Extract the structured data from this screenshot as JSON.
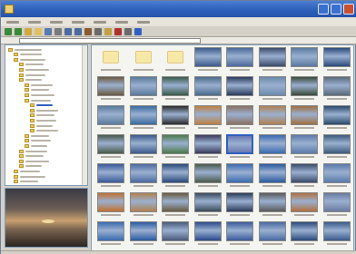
{
  "window": {
    "title": "",
    "accent": "#2c5db8"
  },
  "menubar": {
    "items": [
      "",
      "",
      "",
      "",
      "",
      "",
      ""
    ]
  },
  "toolbar": {
    "tools": [
      {
        "icon": "back-icon",
        "color": "#3a8a3a"
      },
      {
        "icon": "forward-icon",
        "color": "#3a8a3a"
      },
      {
        "icon": "up-folder-icon",
        "color": "#d0a840"
      },
      {
        "icon": "folder-icon",
        "color": "#e0c060"
      },
      {
        "icon": "view-icon",
        "color": "#5a7ab0"
      },
      {
        "icon": "zoom-icon",
        "color": "#7a7a7a"
      },
      {
        "icon": "rotate-left-icon",
        "color": "#4a6aa0"
      },
      {
        "icon": "rotate-right-icon",
        "color": "#4a6aa0"
      },
      {
        "icon": "slideshow-icon",
        "color": "#8a5a30"
      },
      {
        "icon": "print-icon",
        "color": "#6a6a6a"
      },
      {
        "icon": "email-icon",
        "color": "#c0a040"
      },
      {
        "icon": "delete-icon",
        "color": "#b03030"
      },
      {
        "icon": "settings-icon",
        "color": "#6a6a6a"
      },
      {
        "icon": "help-icon",
        "color": "#3060c0"
      }
    ]
  },
  "sidebar": {
    "tree": [
      {
        "level": 0,
        "w": 30
      },
      {
        "level": 1,
        "w": 24
      },
      {
        "level": 1,
        "w": 28
      },
      {
        "level": 2,
        "w": 20
      },
      {
        "level": 2,
        "w": 26
      },
      {
        "level": 2,
        "w": 22
      },
      {
        "level": 2,
        "w": 18
      },
      {
        "level": 3,
        "w": 24
      },
      {
        "level": 3,
        "w": 20
      },
      {
        "level": 3,
        "w": 26
      },
      {
        "level": 3,
        "w": 22
      },
      {
        "level": 4,
        "w": 18,
        "selected": true
      },
      {
        "level": 4,
        "w": 24
      },
      {
        "level": 4,
        "w": 20
      },
      {
        "level": 4,
        "w": 22
      },
      {
        "level": 4,
        "w": 18
      },
      {
        "level": 4,
        "w": 24
      },
      {
        "level": 3,
        "w": 20
      },
      {
        "level": 3,
        "w": 22
      },
      {
        "level": 3,
        "w": 18
      },
      {
        "level": 2,
        "w": 24
      },
      {
        "level": 2,
        "w": 20
      },
      {
        "level": 2,
        "w": 26
      },
      {
        "level": 2,
        "w": 18
      },
      {
        "level": 1,
        "w": 22
      },
      {
        "level": 1,
        "w": 28
      },
      {
        "level": 1,
        "w": 20
      }
    ]
  },
  "thumbnails": [
    [
      "folder",
      "folder",
      "folder",
      "#3a5a8a",
      "#4a6a9a",
      "#3a4a6a",
      "#5a7aa0",
      "#2a4a7a"
    ],
    [
      "#6a5a40",
      "#5a7a9a",
      "#3a5a4a",
      "#4a6a8a",
      "#2a3a5a",
      "#6a8aaa",
      "#3a4a3a",
      "#5a6a7a"
    ],
    [
      "#5a7a9a",
      "#3a6aa0",
      "#2a2a2a",
      "#c08040",
      "#8a7060",
      "#b08050",
      "#a07040",
      "#2a4a6a"
    ],
    [
      "#4a5a4a",
      "#3a5a8a",
      "#4a7a4a",
      "#3a3a5a",
      "#6a7ab0",
      "#3a6ab0",
      "#5a7aaa",
      "#3a5a7a"
    ],
    [
      "#3a5a9a",
      "#4a6aa0",
      "#2a4a7a",
      "#4a5a4a",
      "#3a6ab0",
      "#2a5aa0",
      "#3a4a6a",
      "#5a7aaa"
    ],
    [
      "#c07030",
      "#b08050",
      "#6a5a40",
      "#3a4a5a",
      "#2a3a5a",
      "#5a5a5a",
      "#b07040",
      "#6a7aa0"
    ],
    [
      "#3a6ab0",
      "#2a5aa0",
      "#4a5a7a",
      "#2a4a8a",
      "#3a5a9a",
      "#4a6aa0",
      "#2a4a7a",
      "#3a5a8a"
    ]
  ],
  "selected_thumbnail": [
    3,
    4
  ]
}
